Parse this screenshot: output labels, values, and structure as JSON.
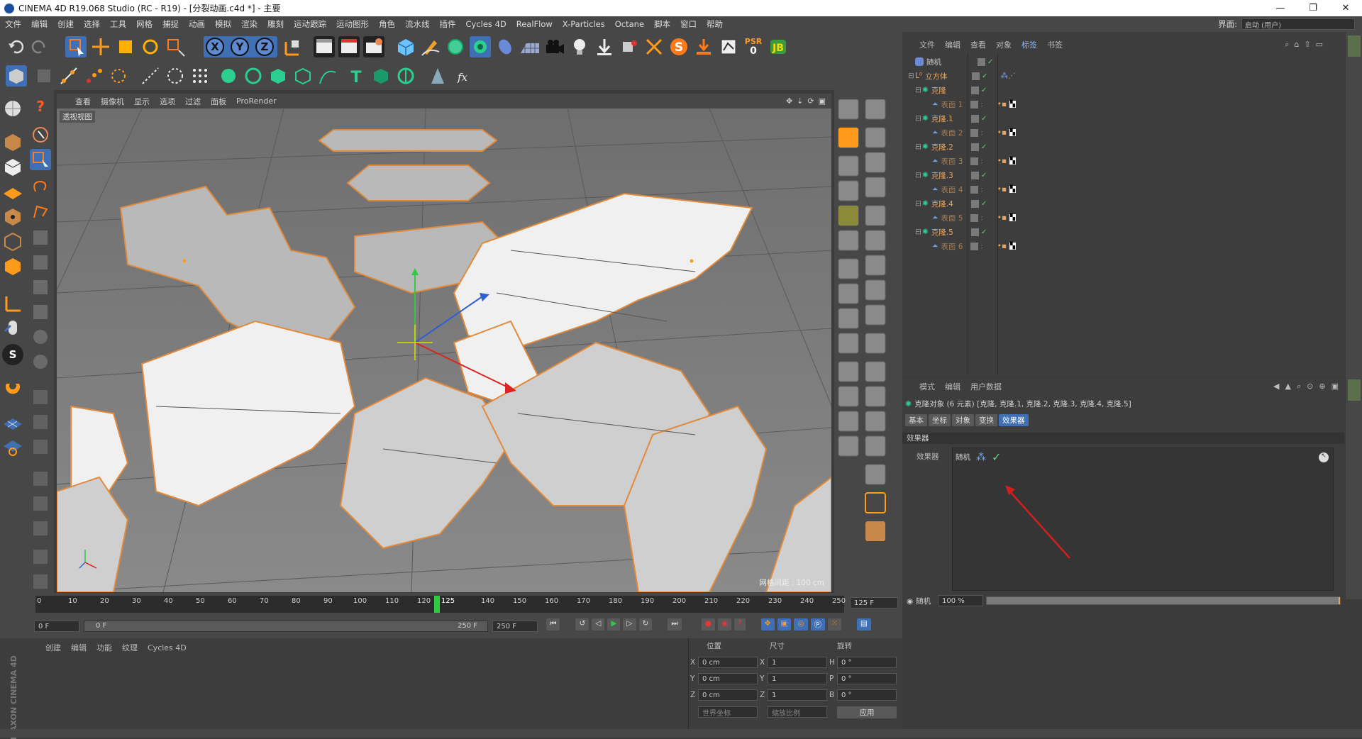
{
  "window": {
    "title": "CINEMA 4D R19.068 Studio (RC - R19) - [分裂动画.c4d *] - 主要"
  },
  "menu": [
    "文件",
    "编辑",
    "创建",
    "选择",
    "工具",
    "网格",
    "捕捉",
    "动画",
    "模拟",
    "渲染",
    "雕刻",
    "运动跟踪",
    "运动图形",
    "角色",
    "流水线",
    "插件",
    "Cycles 4D",
    "RealFlow",
    "X-Particles",
    "Octane",
    "脚本",
    "窗口",
    "帮助"
  ],
  "layout": {
    "label": "界面:",
    "value": "启动 (用户)"
  },
  "toolbar": {
    "psr_label": "PSR",
    "psr_value": "0"
  },
  "viewport": {
    "menu": [
      "查看",
      "摄像机",
      "显示",
      "选项",
      "过滤",
      "面板",
      "ProRender"
    ],
    "name": "透视视图",
    "grid_spacing": "网格间距 : 100 cm"
  },
  "object_manager": {
    "tabs": [
      "文件",
      "编辑",
      "查看",
      "对象",
      "标签",
      "书签"
    ],
    "objects": [
      {
        "name": "随机",
        "indent": 0
      },
      {
        "name": "立方体",
        "indent": 0
      },
      {
        "name": "克隆",
        "indent": 1
      },
      {
        "name": "表面 1",
        "indent": 2
      },
      {
        "name": "克隆.1",
        "indent": 1
      },
      {
        "name": "表面 2",
        "indent": 2
      },
      {
        "name": "克隆.2",
        "indent": 1
      },
      {
        "name": "表面 3",
        "indent": 2
      },
      {
        "name": "克隆.3",
        "indent": 1
      },
      {
        "name": "表面 4",
        "indent": 2
      },
      {
        "name": "克隆.4",
        "indent": 1
      },
      {
        "name": "表面 5",
        "indent": 2
      },
      {
        "name": "克隆.5",
        "indent": 1
      },
      {
        "name": "表面 6",
        "indent": 2
      }
    ]
  },
  "attributes": {
    "tabs": [
      "模式",
      "编辑",
      "用户数据"
    ],
    "header": "克隆对象 (6 元素) [克隆, 克隆.1, 克隆.2, 克隆.3, 克隆.4, 克隆.5]",
    "sub_tabs": [
      "基本",
      "坐标",
      "对象",
      "变换",
      "效果器"
    ],
    "active_sub_tab": "效果器",
    "section": "效果器",
    "field_label": "效果器",
    "effector": "随机",
    "strength_label": "随机",
    "strength_value": "100 %",
    "strength_fraction": 1.0
  },
  "timeline": {
    "ticks": [
      "0",
      "10",
      "20",
      "30",
      "40",
      "50",
      "60",
      "70",
      "80",
      "90",
      "100",
      "110",
      "120",
      "125",
      "140",
      "150",
      "160",
      "170",
      "180",
      "190",
      "200",
      "210",
      "220",
      "230",
      "240",
      "250"
    ],
    "current_frame": "125",
    "end_label": "125 F",
    "start_field": "0 F",
    "range_start": "0 F",
    "range_end": "250 F",
    "end_field": "250 F"
  },
  "material_manager": {
    "tabs": [
      "创建",
      "编辑",
      "功能",
      "纹理",
      "Cycles 4D"
    ]
  },
  "coordinates": {
    "headers": [
      "位置",
      "尺寸",
      "旋转"
    ],
    "rows": [
      {
        "axis": "X",
        "pos": "0 cm",
        "size_axis": "X",
        "size": "1",
        "rot_axis": "H",
        "rot": "0 °"
      },
      {
        "axis": "Y",
        "pos": "0 cm",
        "size_axis": "Y",
        "size": "1",
        "rot_axis": "P",
        "rot": "0 °"
      },
      {
        "axis": "Z",
        "pos": "0 cm",
        "size_axis": "Z",
        "size": "1",
        "rot_axis": "B",
        "rot": "0 °"
      }
    ],
    "world_select": "世界坐标",
    "scale_select": "缩放比例",
    "apply": "应用"
  },
  "brand": "MAXON CINEMA 4D",
  "colors": {
    "accent": "#3f6fb5",
    "object_orange": "#e8a45c",
    "check_green": "#5cd27a",
    "panel": "#3d3d3d"
  }
}
